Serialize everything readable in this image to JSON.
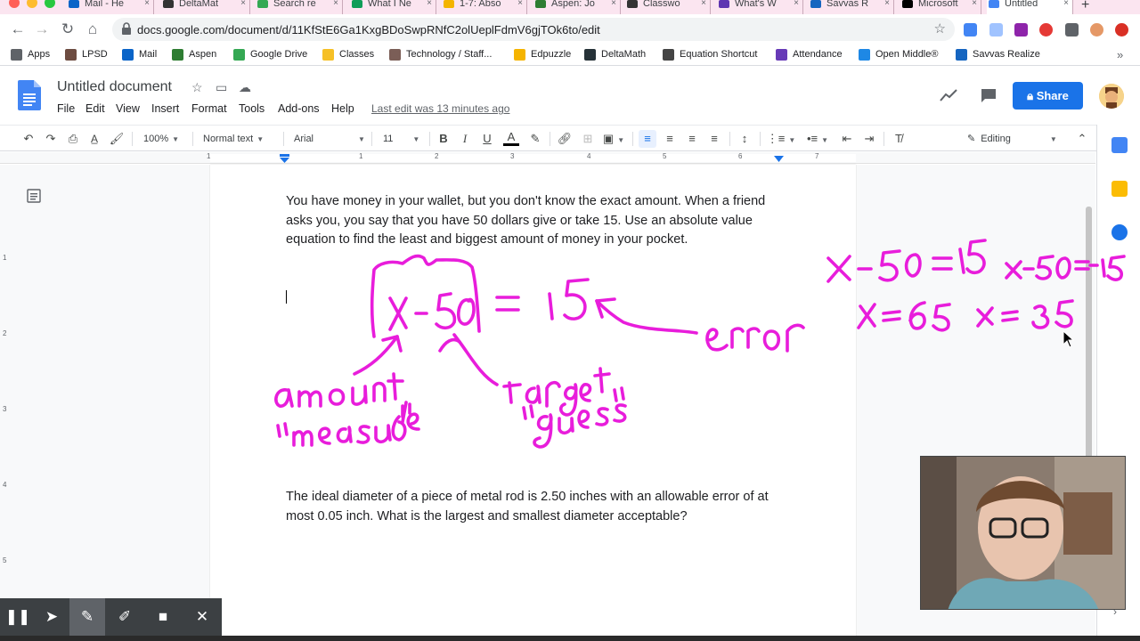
{
  "browser": {
    "tabs": [
      {
        "label": "Mail - He",
        "color": "#0a64c8"
      },
      {
        "label": "DeltaMat",
        "color": "#333333"
      },
      {
        "label": "Search re",
        "color": "#34a853"
      },
      {
        "label": "What I Ne",
        "color": "#0f9d58"
      },
      {
        "label": "1-7: Abso",
        "color": "#f4b400"
      },
      {
        "label": "Aspen: Jo",
        "color": "#2e7d32"
      },
      {
        "label": "Classwo",
        "color": "#333333"
      },
      {
        "label": "What's W",
        "color": "#5e35b1"
      },
      {
        "label": "Savvas R",
        "color": "#1565c0"
      },
      {
        "label": "Microsoft",
        "color": "#000000"
      },
      {
        "label": "Untitled",
        "color": "#4285f4"
      }
    ],
    "url": "docs.google.com/document/d/11KfStE6Ga1KxgBDoSwpRNfC2olUeplFdmV6gjTOk6to/edit",
    "bookmarks": [
      {
        "label": "Apps",
        "color": "#5f6368"
      },
      {
        "label": "LPSD",
        "color": "#6d4c41"
      },
      {
        "label": "Mail",
        "color": "#0a64c8"
      },
      {
        "label": "Aspen",
        "color": "#2e7d32"
      },
      {
        "label": "Google Drive",
        "color": "#34a853"
      },
      {
        "label": "Classes",
        "color": "#f6c026"
      },
      {
        "label": "Technology / Staff...",
        "color": "#7b5e57"
      },
      {
        "label": "Edpuzzle",
        "color": "#f5b400"
      },
      {
        "label": "DeltaMath",
        "color": "#263238"
      },
      {
        "label": "Equation Shortcut",
        "color": "#444444"
      },
      {
        "label": "Attendance",
        "color": "#673ab7"
      },
      {
        "label": "Open Middle®",
        "color": "#1e88e5"
      },
      {
        "label": "Savvas Realize",
        "color": "#1565c0"
      }
    ],
    "more_bookmarks": "»"
  },
  "docs": {
    "title": "Untitled document",
    "menus": [
      "File",
      "Edit",
      "View",
      "Insert",
      "Format",
      "Tools",
      "Add-ons",
      "Help"
    ],
    "last_edit": "Last edit was 13 minutes ago",
    "share_label": "Share",
    "toolbar": {
      "zoom": "100%",
      "style": "Normal text",
      "font": "Arial",
      "size": "11",
      "mode": "Editing"
    },
    "ruler_marks": [
      "1",
      "1",
      "2",
      "3",
      "4",
      "5",
      "6",
      "7"
    ],
    "vruler_marks": [
      "1",
      "2",
      "3",
      "4",
      "5"
    ],
    "problem1": "You have money in your wallet, but you don't know the exact amount. When a friend asks you, you say that you have 50 dollars give or take 15. Use an absolute value equation to find the least and biggest amount of money in your pocket.",
    "problem2": "The ideal diameter of a piece of metal rod is 2.50 inches with an allowable error of at most 0.05 inch. What is the largest and smallest diameter acceptable?"
  },
  "annotations": {
    "main_equation": "|x-50| = 15",
    "error_label": "error",
    "amount_label": "amount",
    "measure_label": "\"measure\"",
    "target_label": "target",
    "guess_label": "\"guess\"",
    "eq_pos": "x-50=15",
    "eq_neg": "x-50=-15",
    "sol_pos": "x=65",
    "sol_neg": "x=35",
    "ink_color": "#e81ddb"
  },
  "screencast": {
    "buttons": [
      "pause",
      "pointer",
      "pen",
      "highlighter",
      "camera",
      "close"
    ]
  }
}
